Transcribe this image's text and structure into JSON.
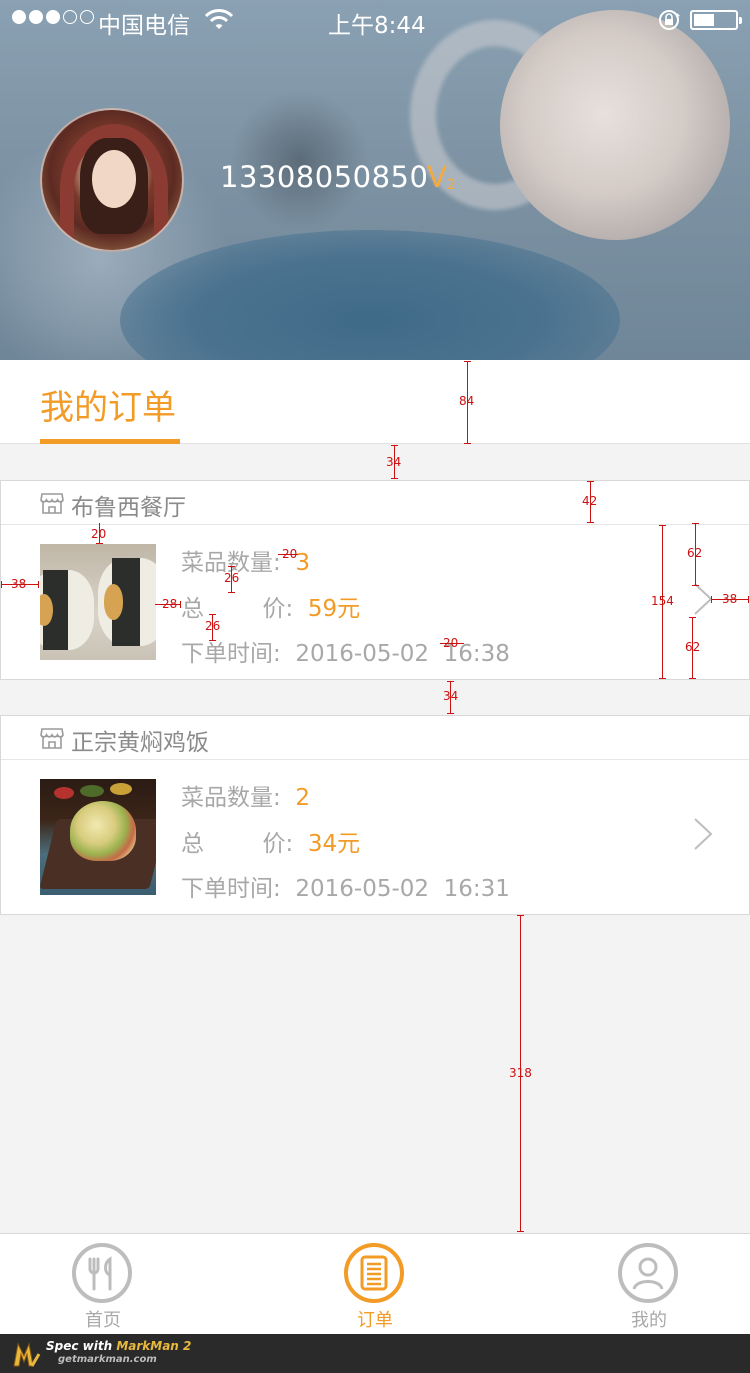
{
  "status_bar": {
    "carrier": "中国电信",
    "time": "上午8:44"
  },
  "profile": {
    "phone": "13308050850",
    "vip_letter": "V",
    "vip_level": "2"
  },
  "section": {
    "title": "我的订单"
  },
  "labels": {
    "dish_count": "菜品数量:",
    "total_price": "总        价:",
    "order_time": "下单时间:"
  },
  "orders": [
    {
      "store": "布鲁西餐厅",
      "dish_count": "3",
      "total": "59元",
      "time": "2016-05-02  16:38"
    },
    {
      "store": "正宗黄焖鸡饭",
      "dish_count": "2",
      "total": "34元",
      "time": "2016-05-02  16:31"
    }
  ],
  "measurements": {
    "title_bar_height": "84",
    "gap_top": "34",
    "store_header_height": "42",
    "image_top": "20",
    "left_margin": "38",
    "text_gap": "20",
    "line_gap_1": "26",
    "image_text_gap": "28",
    "line_gap_2": "26",
    "time_gap": "20",
    "card_height": "154",
    "chevron_top": "62",
    "chevron_bottom": "62",
    "right_margin": "38",
    "gap_between": "34",
    "bottom_space": "318"
  },
  "tabs": [
    {
      "label": "首页",
      "icon": "fork-knife-icon",
      "active": false
    },
    {
      "label": "订单",
      "icon": "order-list-icon",
      "active": true
    },
    {
      "label": "我的",
      "icon": "user-icon",
      "active": false
    }
  ],
  "footer": {
    "line1_prefix": "Spec with ",
    "line1_brand": "MarkMan 2",
    "line2": "getmarkman.com"
  },
  "colors": {
    "accent": "#f29b26",
    "annotation": "#cc1111",
    "muted_text": "#a8a8a8"
  }
}
